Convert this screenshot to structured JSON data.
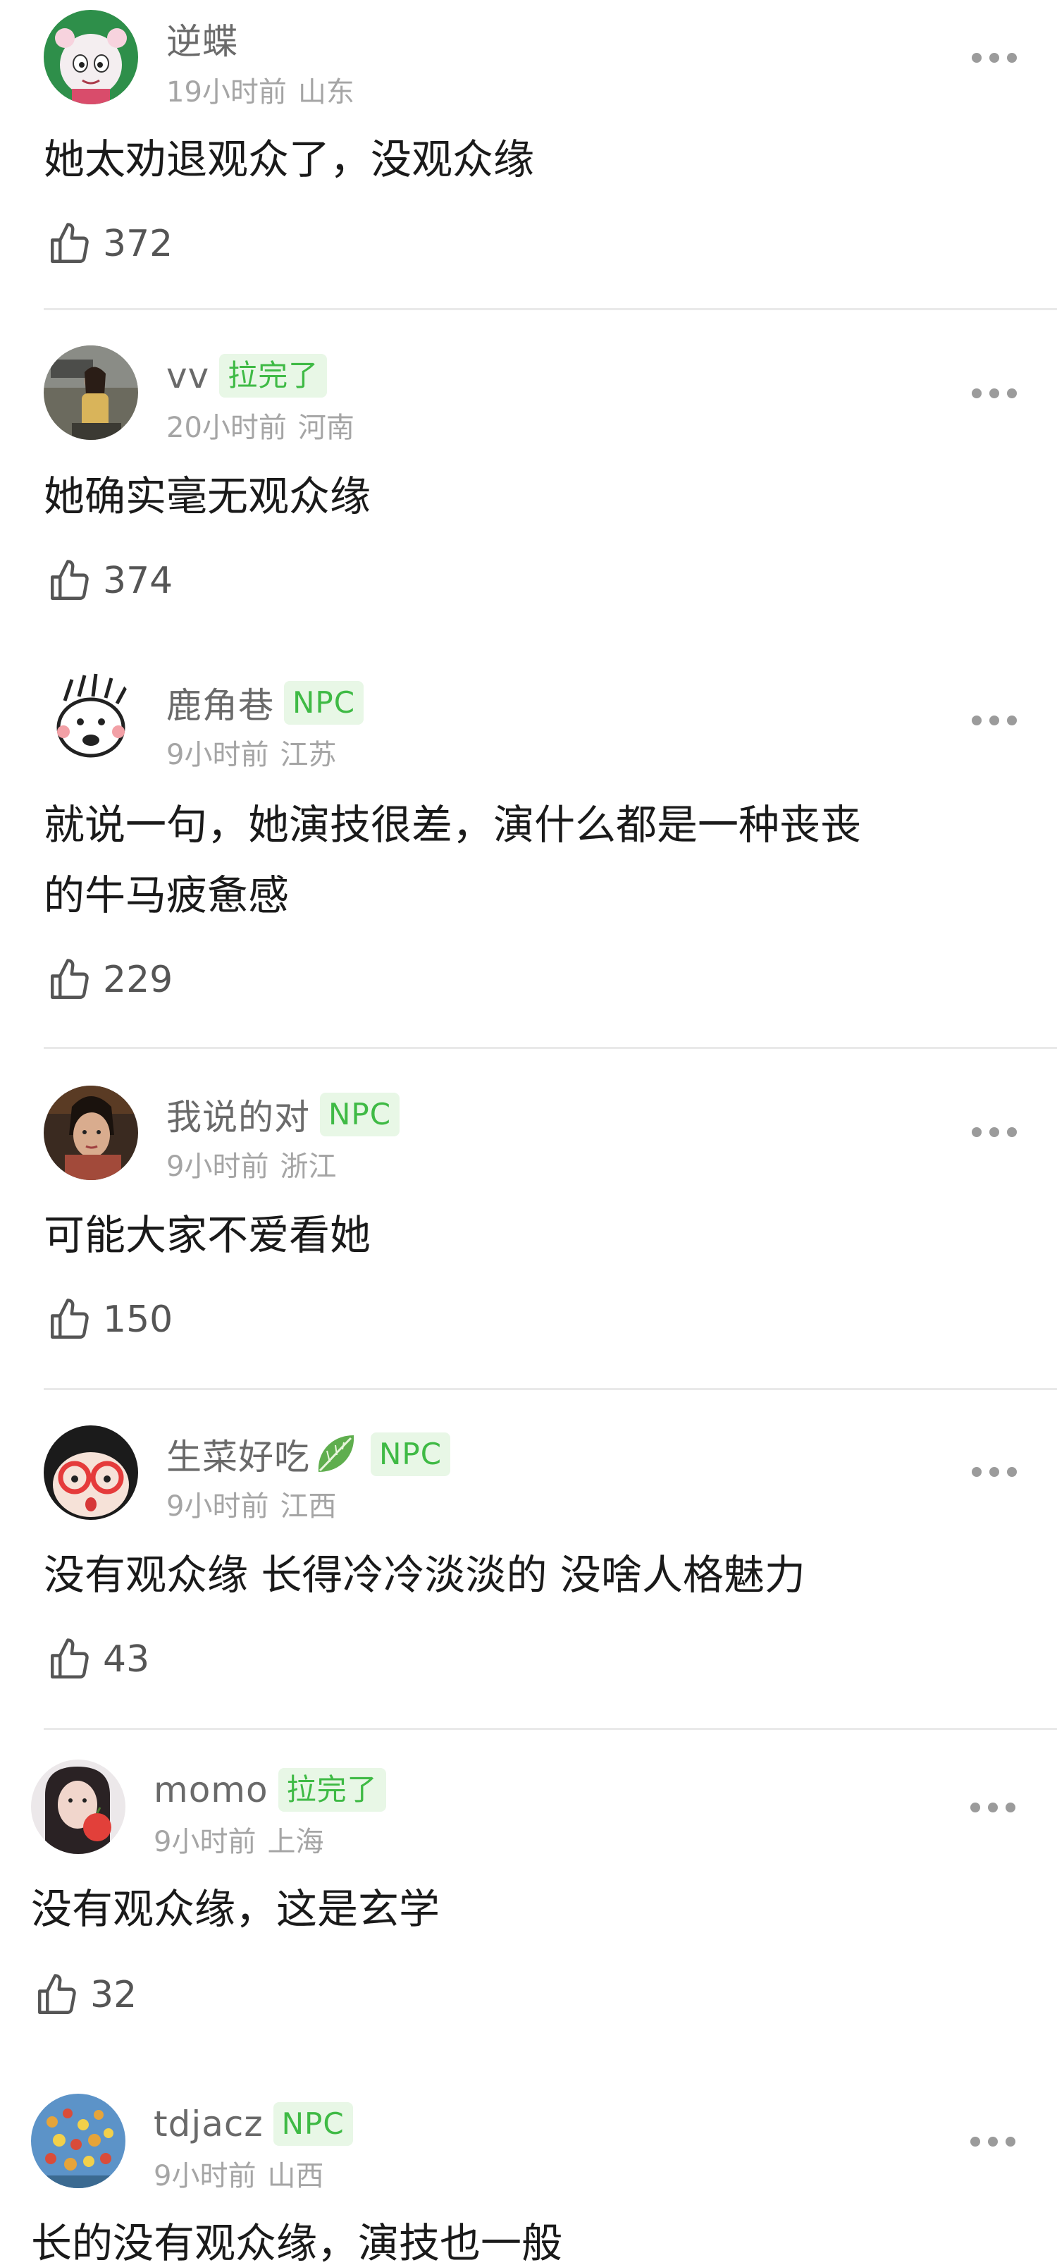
{
  "comments": [
    {
      "username": "逆蝶",
      "badge": "",
      "time": "19小时前",
      "location": "山东",
      "text": "她太劝退观众了，没观众缘",
      "likes": "372",
      "avatar_icon": "cartoon-goat-avatar",
      "avatar_colors": {
        "bg": "#2e8f4a",
        "accent": "#f3e6ea"
      }
    },
    {
      "username": "vv",
      "badge": "拉完了",
      "time": "20小时前",
      "location": "河南",
      "text": "她确实毫无观众缘",
      "likes": "374",
      "avatar_icon": "photo-woman-avatar",
      "avatar_colors": {
        "bg": "#6b6a5e",
        "accent": "#d9b45a"
      }
    },
    {
      "username": "鹿角巷",
      "badge": "NPC",
      "time": "9小时前",
      "location": "江苏",
      "text": "就说一句，她演技很差，演什么都是一种丧丧\n的牛马疲惫感",
      "likes": "229",
      "avatar_icon": "doodle-face-avatar",
      "avatar_colors": {
        "bg": "#ffffff",
        "accent": "#222222"
      }
    },
    {
      "username": "我说的对",
      "badge": "NPC",
      "time": "9小时前",
      "location": "浙江",
      "text": "可能大家不爱看她",
      "likes": "150",
      "avatar_icon": "photo-actress-avatar",
      "avatar_colors": {
        "bg": "#3a2a20",
        "accent": "#c99a7c"
      }
    },
    {
      "username": "生菜好吃",
      "badge": "NPC",
      "has_leaf": true,
      "time": "9小时前",
      "location": "江西",
      "text": "没有观众缘 长得冷冷淡淡的 没啥人格魅力",
      "likes": "43",
      "avatar_icon": "cartoon-glasses-avatar",
      "avatar_colors": {
        "bg": "#1b1b1b",
        "accent": "#e53b3b"
      }
    },
    {
      "username": "momo",
      "badge": "拉完了",
      "time": "9小时前",
      "location": "上海",
      "text": "没有观众缘，这是玄学",
      "likes": "32",
      "avatar_icon": "photo-girl-apple-avatar",
      "avatar_colors": {
        "bg": "#2a2224",
        "accent": "#e2403a"
      }
    },
    {
      "username": "tdjacz",
      "badge": "NPC",
      "time": "9小时前",
      "location": "山西",
      "text": "长的没有观众缘，演技也一般",
      "likes": "",
      "avatar_icon": "balloons-sky-avatar",
      "avatar_colors": {
        "bg": "#5c93c8",
        "accent": "#e6a43a"
      }
    }
  ],
  "colors": {
    "badge_bg": "#e8f7e6",
    "badge_text": "#3fba45",
    "username": "#6a6a6a",
    "meta": "#a5a5a5",
    "text": "#1a1a1a"
  },
  "icons": {
    "like": "thumbs-up-icon",
    "more": "more-dots-icon",
    "leaf": "lettuce-leaf-icon"
  }
}
